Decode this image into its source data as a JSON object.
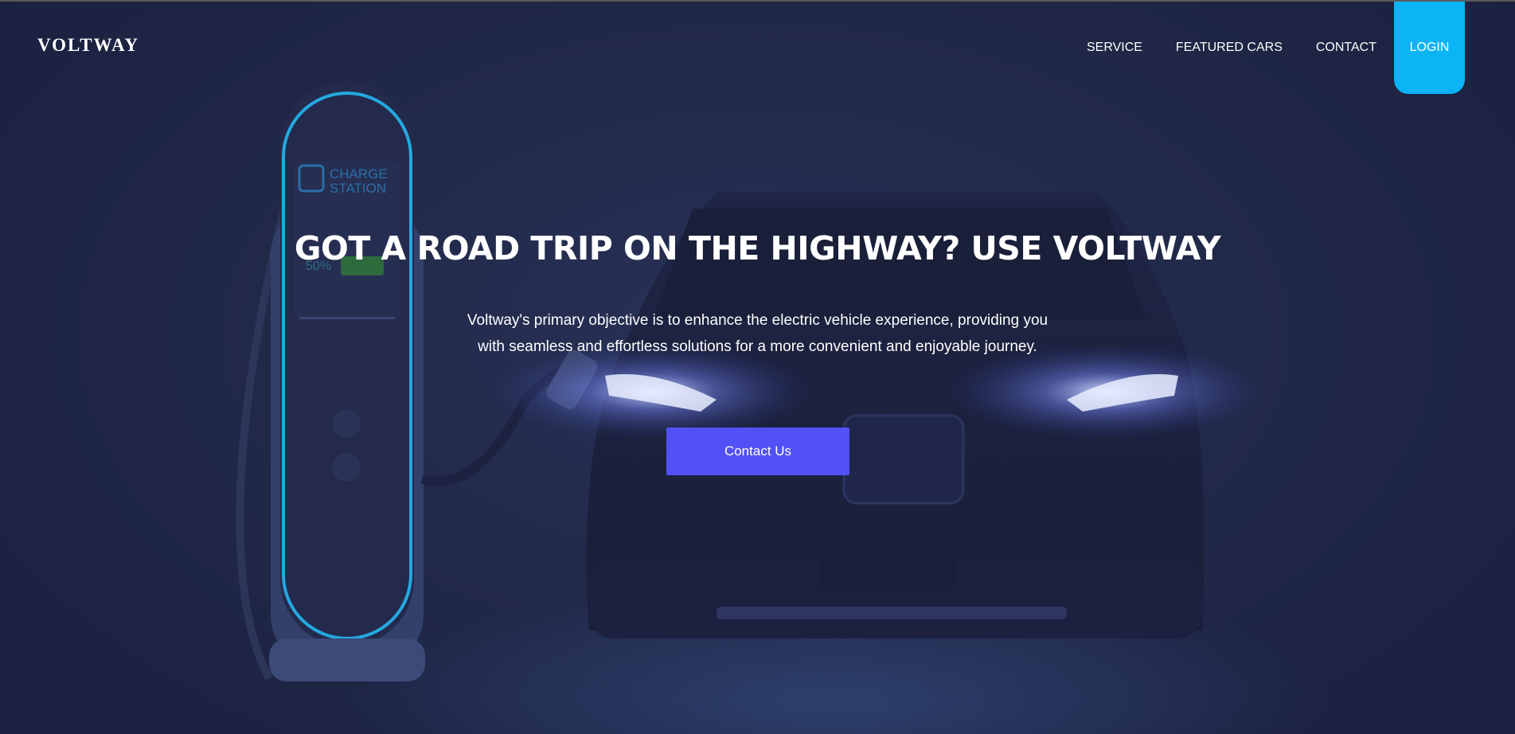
{
  "brand": {
    "logo_text": "VOLTWAY"
  },
  "nav": {
    "items": [
      {
        "label": "SERVICE"
      },
      {
        "label": "FEATURED CARS"
      },
      {
        "label": "CONTACT"
      }
    ],
    "login_label": "LOGIN"
  },
  "hero": {
    "headline": "GOT A ROAD TRIP ON THE HIGHWAY? USE VOLTWAY",
    "description": "Voltway's primary objective is to enhance the electric vehicle experience, providing you with seamless and effortless solutions for a more convenient and enjoyable journey.",
    "cta_label": "Contact Us",
    "illustration": {
      "station_label_line1": "CHARGE",
      "station_label_line2": "STATION",
      "battery_percent": "50%"
    }
  },
  "colors": {
    "background": "#1d2340",
    "accent_login": "#0ab4f5",
    "accent_cta": "#5151f5",
    "station_glow": "#25a8e0"
  }
}
